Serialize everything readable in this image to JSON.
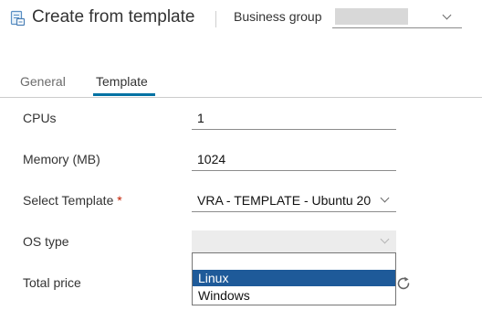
{
  "header": {
    "title": "Create from template",
    "business_group_label": "Business group",
    "business_group_value": ""
  },
  "tabs": [
    {
      "label": "General",
      "active": false
    },
    {
      "label": "Template",
      "active": true
    }
  ],
  "form": {
    "cpus": {
      "label": "CPUs",
      "value": "1"
    },
    "memory": {
      "label": "Memory (MB)",
      "value": "1024"
    },
    "select_template": {
      "label": "Select Template",
      "required_mark": "*",
      "value": "VRA - TEMPLATE - Ubuntu 20"
    },
    "os_type": {
      "label": "OS type",
      "value": "",
      "options": [
        "",
        "Linux",
        "Windows"
      ],
      "highlighted_option": "Linux"
    },
    "total_price": {
      "label": "Total price"
    }
  },
  "icons": {
    "header": "template-icon",
    "refresh": "refresh-icon",
    "chevron": "chevron-down-icon"
  },
  "colors": {
    "accent": "#0072a3",
    "required": "#c21d00",
    "option_highlight": "#1e5a99"
  }
}
